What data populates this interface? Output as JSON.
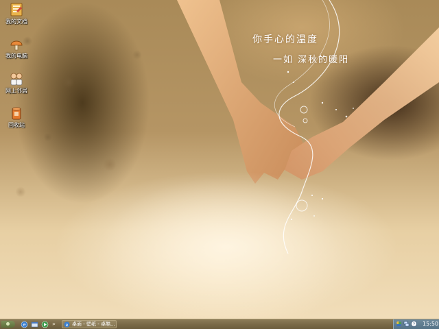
{
  "desktop": {
    "icons": [
      {
        "label": "我的文档",
        "icon": "my-documents-icon"
      },
      {
        "label": "我的电脑",
        "icon": "my-computer-icon"
      },
      {
        "label": "网上邻居",
        "icon": "network-places-icon"
      },
      {
        "label": "回收站",
        "icon": "recycle-bin-icon"
      }
    ],
    "wallpaper_text": {
      "line1": "你手心的温度",
      "line2": "一如  深秋的暖阳"
    }
  },
  "taskbar": {
    "quick_launch": [
      {
        "icon": "internet-explorer-icon"
      },
      {
        "icon": "show-desktop-icon"
      },
      {
        "icon": "media-player-icon"
      }
    ],
    "more_label": "»",
    "active_window": {
      "label": "桌面 - 壁纸 - 桌酷...",
      "icon": "browser-window-icon"
    },
    "tray_icons": [
      "msn-messenger-icon",
      "network-connection-icon",
      "help-icon"
    ],
    "clock": "15:50"
  },
  "colors": {
    "taskbar": "#7a6a48",
    "tray": "#557387",
    "wallpaper_warm": "#e7cfa3"
  }
}
